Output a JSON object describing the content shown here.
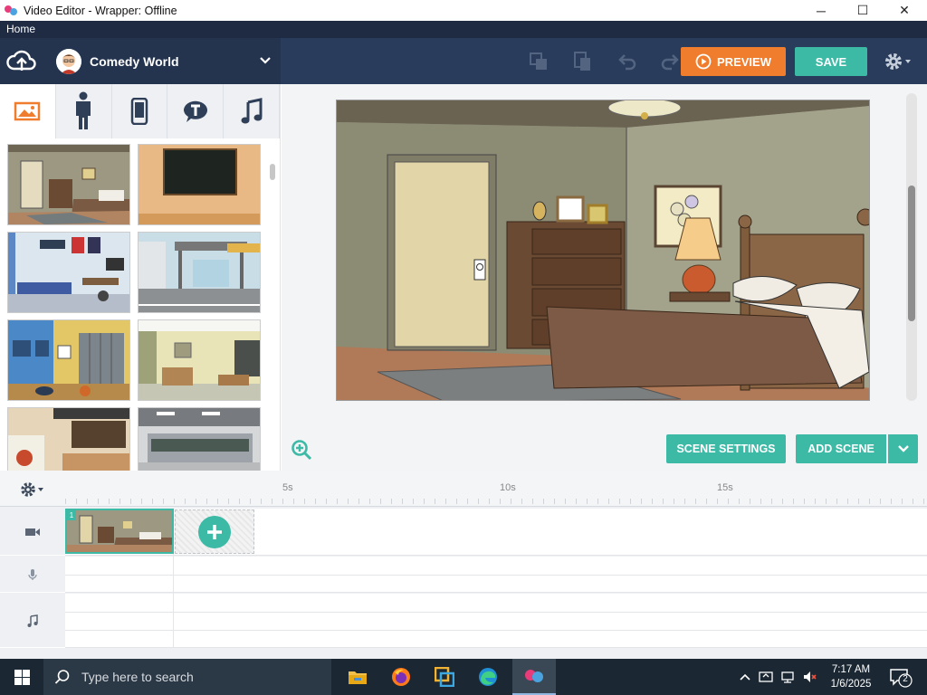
{
  "window": {
    "title": "Video Editor - Wrapper: Offline",
    "minimize": "─",
    "maximize": "☐",
    "close": "✕"
  },
  "menubar": {
    "home": "Home"
  },
  "header": {
    "project_name": "Comedy World",
    "preview_label": "PREVIEW",
    "save_label": "SAVE"
  },
  "panel": {
    "tabs": [
      "background-icon",
      "character-icon",
      "prop-icon",
      "text-icon",
      "music-icon"
    ],
    "thumbnails": [
      "bedroom",
      "chalkboard",
      "teen-bedroom",
      "bus-stop",
      "locker-room",
      "classroom",
      "coffee-shop",
      "cafeteria"
    ]
  },
  "stage": {
    "scene_settings_label": "SCENE SETTINGS",
    "add_scene_label": "ADD SCENE"
  },
  "timeline": {
    "ruler_labels": [
      "5s",
      "10s",
      "15s"
    ],
    "scene_number": "1"
  },
  "taskbar": {
    "search_placeholder": "Type here to search",
    "time": "7:17 AM",
    "date": "1/6/2025",
    "notification_count": "2"
  },
  "colors": {
    "accent_teal": "#3cbaa6",
    "accent_orange": "#f07d2d",
    "header_navy": "#2a3c5c",
    "menubar_navy": "#1e2b43"
  }
}
